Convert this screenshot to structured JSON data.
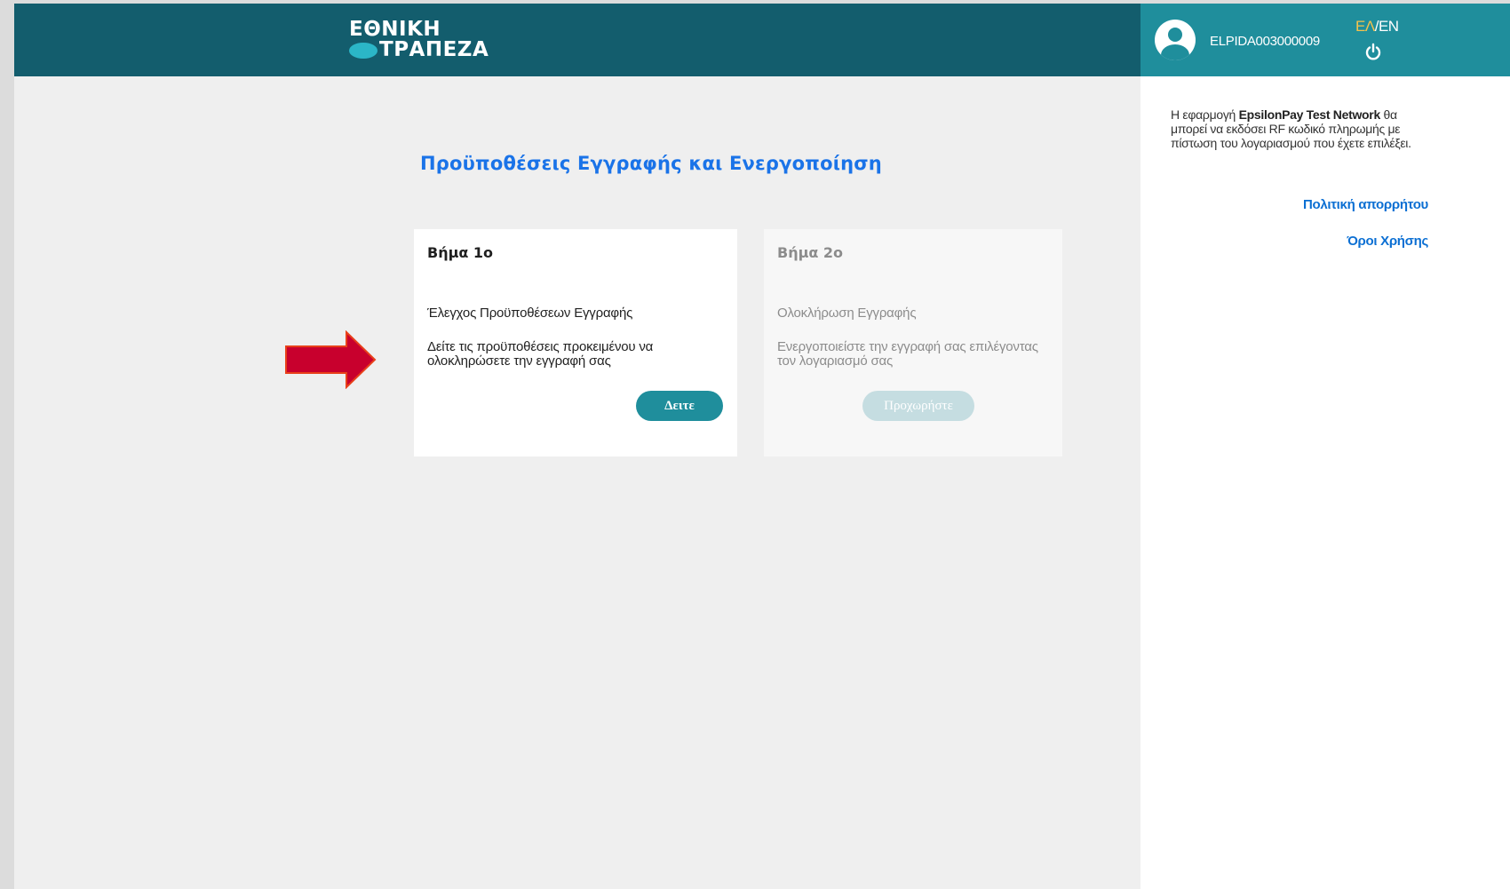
{
  "header": {
    "logo_line1": "ΕΘΝΙΚΗ",
    "logo_line2": "ΤΡΑΠΕΖΑ",
    "username": "ELPIDA003000009",
    "lang_el": "ΕΛ",
    "lang_sep": "/",
    "lang_en": "EN"
  },
  "sidebar": {
    "info_prefix": "Η εφαρμογή ",
    "info_bold": "EpsilonPay Test Network",
    "info_suffix": " θα μπορεί να εκδόσει RF κωδικό πληρωμής με πίστωση του λογαριασμού που έχετε επιλέξει.",
    "privacy_link": "Πολιτική απορρήτου",
    "terms_link": "Όροι Χρήσης"
  },
  "main": {
    "title": "Προϋποθέσεις Εγγραφής και Ενεργοποίηση",
    "steps": [
      {
        "step": "Βήμα 1ο",
        "heading": "Έλεγχος Προϋποθέσεων Εγγραφής",
        "description": "Δείτε τις προϋποθέσεις προκειμένου να ολοκληρώσετε την εγγραφή σας",
        "button": "Δειτε"
      },
      {
        "step": "Βήμα 2ο",
        "heading": "Ολοκλήρωση Εγγραφής",
        "description": "Ενεργοποιείστε την εγγραφή σας επιλέγοντας τον λογαριασμό σας",
        "button": "Προχωρήστε"
      }
    ]
  },
  "colors": {
    "header": "#135d6d",
    "userbar": "#1f8e9c",
    "title": "#1a73e8",
    "arrow": "#c8002d"
  }
}
